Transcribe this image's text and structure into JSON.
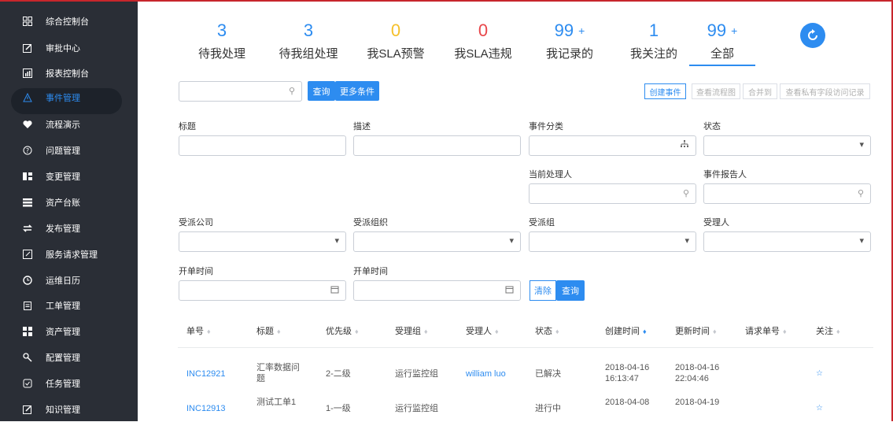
{
  "sidebar": {
    "items": [
      {
        "label": "综合控制台",
        "icon": "grid-icon"
      },
      {
        "label": "审批中心",
        "icon": "edit-icon"
      },
      {
        "label": "报表控制台",
        "icon": "chart-icon"
      },
      {
        "label": "事件管理",
        "icon": "warning-icon",
        "active": true
      },
      {
        "label": "流程演示",
        "icon": "heart-icon"
      },
      {
        "label": "问题管理",
        "icon": "question-icon"
      },
      {
        "label": "变更管理",
        "icon": "change-icon"
      },
      {
        "label": "资产台账",
        "icon": "list-icon"
      },
      {
        "label": "发布管理",
        "icon": "release-icon"
      },
      {
        "label": "服务请求管理",
        "icon": "request-icon"
      },
      {
        "label": "运维日历",
        "icon": "clock-icon"
      },
      {
        "label": "工单管理",
        "icon": "clipboard-icon"
      },
      {
        "label": "资产管理",
        "icon": "asset-icon"
      },
      {
        "label": "配置管理",
        "icon": "config-icon"
      },
      {
        "label": "任务管理",
        "icon": "task-icon"
      },
      {
        "label": "知识管理",
        "icon": "knowledge-icon"
      }
    ]
  },
  "stats": [
    {
      "num": "3",
      "plus": "",
      "label": "待我处理",
      "color": "#2d8cf0"
    },
    {
      "num": "3",
      "plus": "",
      "label": "待我组处理",
      "color": "#2d8cf0"
    },
    {
      "num": "0",
      "plus": "",
      "label": "我SLA预警",
      "color": "#f5c02b"
    },
    {
      "num": "0",
      "plus": "",
      "label": "我SLA违规",
      "color": "#e8464a"
    },
    {
      "num": "99",
      "plus": "+",
      "label": "我记录的",
      "color": "#2d8cf0"
    },
    {
      "num": "1",
      "plus": "",
      "label": "我关注的",
      "color": "#2d8cf0"
    },
    {
      "num": "99",
      "plus": "+",
      "label": "全部",
      "color": "#2d8cf0"
    }
  ],
  "toolbar": {
    "query": "查询",
    "more": "更多条件",
    "create": "创建事件",
    "flow": "查看流程图",
    "merge": "合并到",
    "private": "查看私有字段访问记录"
  },
  "form": {
    "title": "标题",
    "desc": "描述",
    "category": "事件分类",
    "status": "状态",
    "handler": "当前处理人",
    "reporter": "事件报告人",
    "company": "受派公司",
    "org": "受派组织",
    "group": "受派组",
    "assignee": "受理人",
    "start1": "开单时间",
    "start2": "开单时间",
    "clear": "清除",
    "query": "查询"
  },
  "table": {
    "headers": [
      "单号",
      "标题",
      "优先级",
      "受理组",
      "受理人",
      "状态",
      "创建时间",
      "更新时间",
      "请求单号",
      "关注"
    ],
    "rows": [
      {
        "id": "INC12921",
        "title1": "汇率数据问",
        "title2": "题",
        "priority": "2-二级",
        "group": "运行监控组",
        "assignee": "william luo",
        "status": "已解决",
        "created1": "2018-04-16",
        "created2": "16:13:47",
        "updated1": "2018-04-16",
        "updated2": "22:04:46",
        "follow": "☆"
      },
      {
        "id": "INC12913",
        "title1": "测试工单1",
        "title2": "",
        "priority": "1-一级",
        "group": "运行监控组",
        "assignee": "",
        "status": "进行中",
        "created1": "2018-04-08",
        "created2": "",
        "updated1": "2018-04-19",
        "updated2": "",
        "follow": "☆"
      }
    ]
  }
}
